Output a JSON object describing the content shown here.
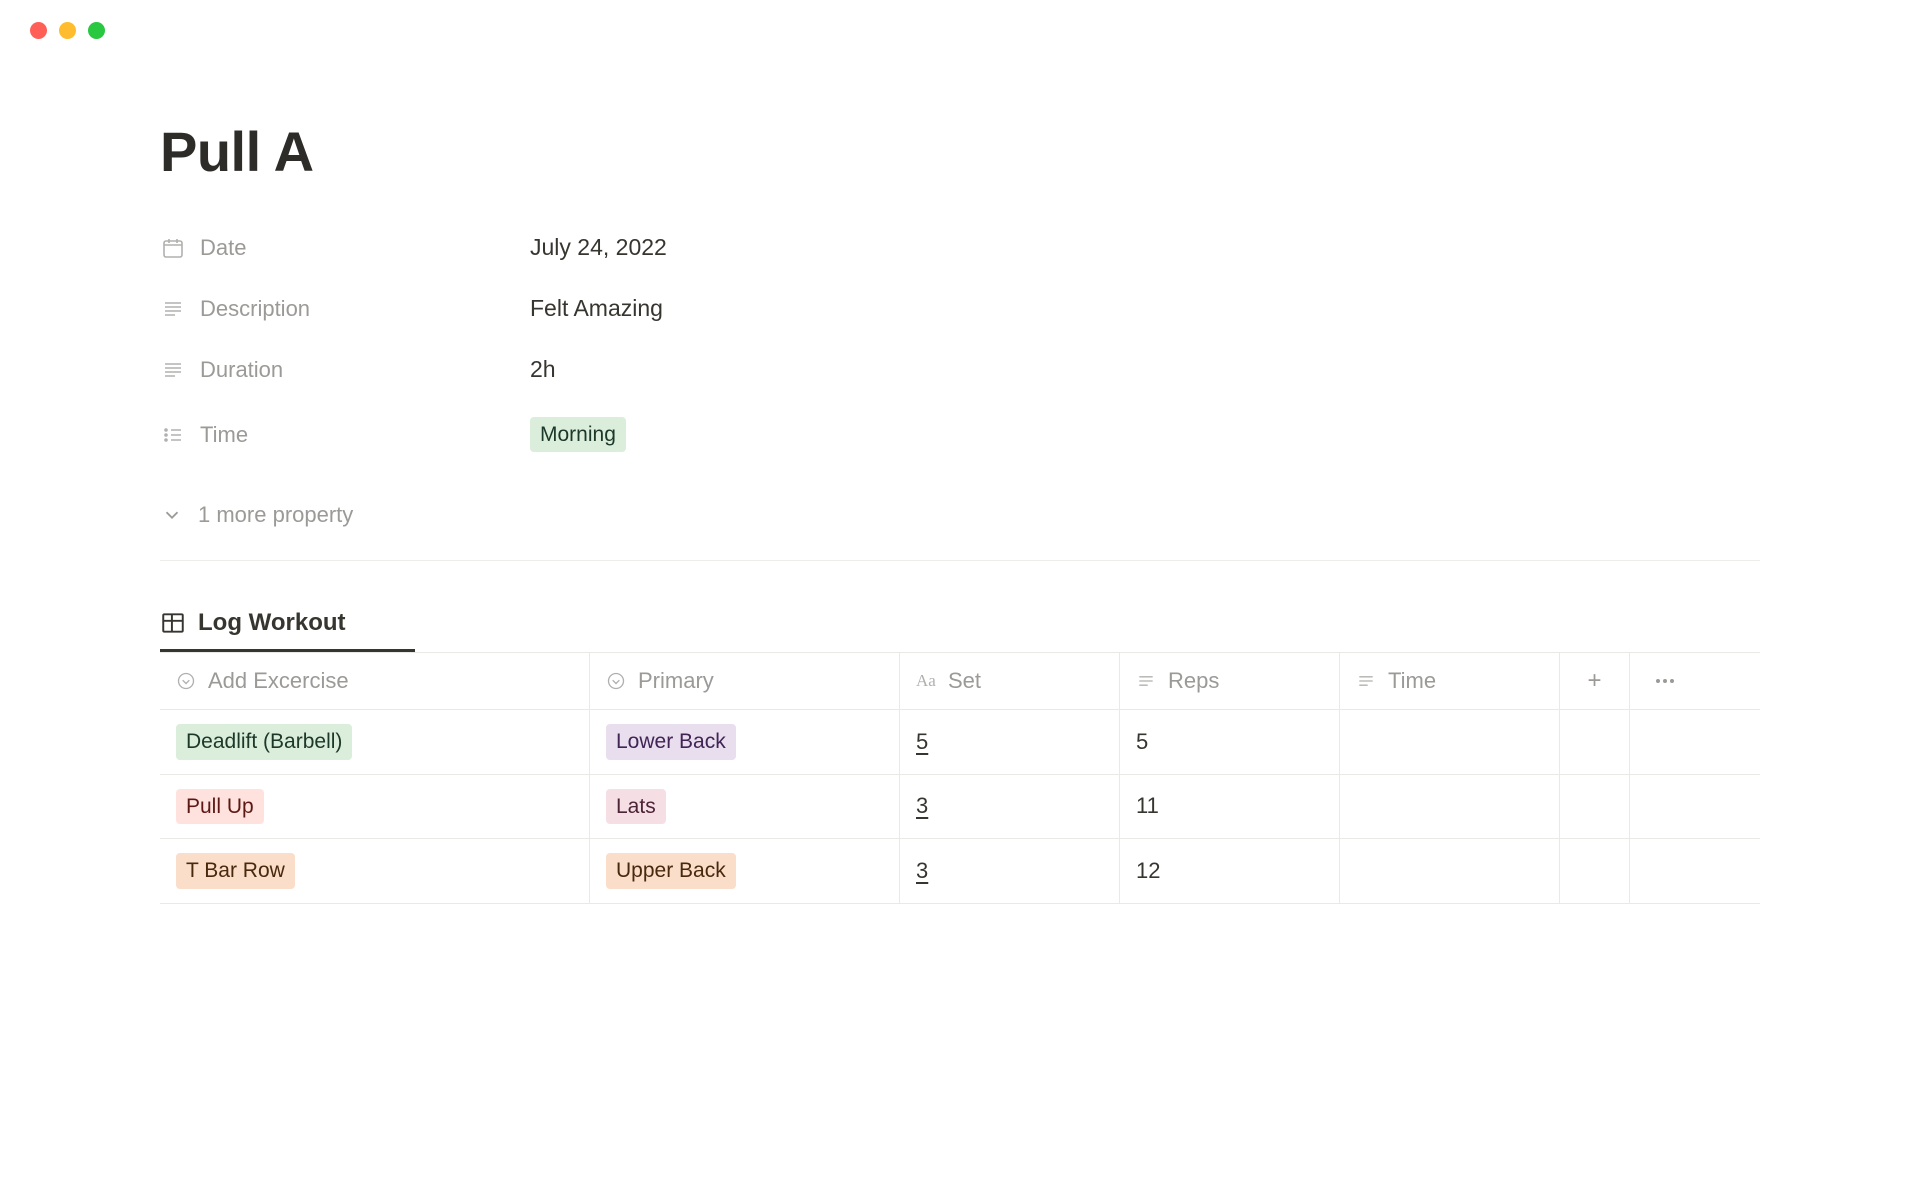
{
  "title": "Pull A",
  "properties": {
    "date": {
      "label": "Date",
      "value": "July 24, 2022"
    },
    "description": {
      "label": "Description",
      "value": "Felt Amazing"
    },
    "duration": {
      "label": "Duration",
      "value": "2h"
    },
    "time": {
      "label": "Time",
      "value": "Morning",
      "tag_color": "green"
    }
  },
  "more_properties_label": "1 more property",
  "database": {
    "title": "Log Workout",
    "columns": {
      "exercise": "Add Excercise",
      "primary": "Primary",
      "set": "Set",
      "reps": "Reps",
      "time": "Time"
    },
    "rows": [
      {
        "exercise": "Deadlift (Barbell)",
        "exercise_color": "green",
        "primary": "Lower Back",
        "primary_color": "purple",
        "set": "5",
        "reps": "5",
        "time": ""
      },
      {
        "exercise": "Pull Up",
        "exercise_color": "red",
        "primary": "Lats",
        "primary_color": "pink",
        "set": "3",
        "reps": "11",
        "time": ""
      },
      {
        "exercise": "T Bar Row",
        "exercise_color": "orange",
        "primary": "Upper Back",
        "primary_color": "orange",
        "set": "3",
        "reps": "12",
        "time": ""
      }
    ]
  }
}
